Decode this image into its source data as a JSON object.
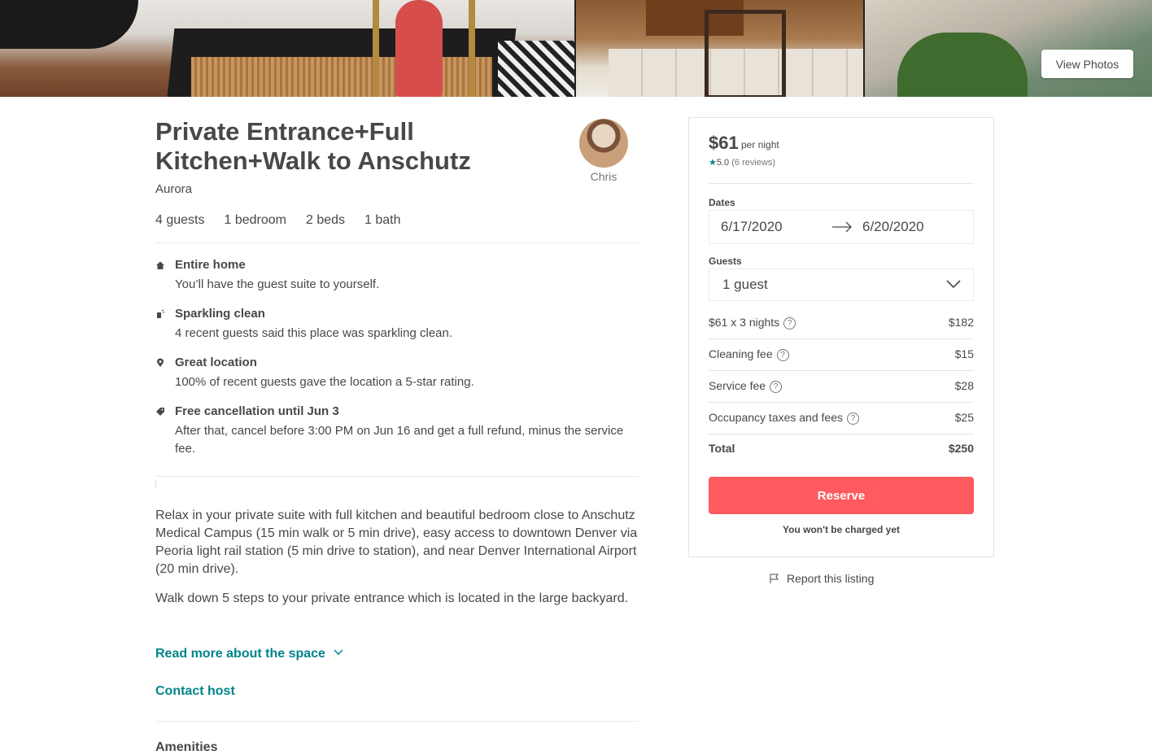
{
  "photos": {
    "view_photos_label": "View Photos"
  },
  "listing": {
    "title": "Private Entrance+Full Kitchen+Walk to Anschutz",
    "city": "Aurora",
    "host_name": "Chris",
    "stats": [
      "4 guests",
      "1 bedroom",
      "2 beds",
      "1 bath"
    ]
  },
  "highlights": [
    {
      "icon": "home-icon",
      "title": "Entire home",
      "desc": "You’ll have the guest suite to yourself."
    },
    {
      "icon": "broom-icon",
      "title": "Sparkling clean",
      "desc": "4 recent guests said this place was sparkling clean."
    },
    {
      "icon": "location-pin-icon",
      "title": "Great location",
      "desc": "100% of recent guests gave the location a 5-star rating."
    },
    {
      "icon": "tag-icon",
      "title": "Free cancellation until Jun 3",
      "desc": "After that, cancel before 3:00 PM on Jun 16 and get a full refund, minus the service fee."
    }
  ],
  "description": {
    "p1": "Relax in your private suite with full kitchen and beautiful bedroom close to Anschutz Medical Campus (15 min walk or 5 min drive), easy access to downtown Denver via Peoria light rail station (5 min drive to station), and near Denver International Airport (20 min drive).",
    "p2": "Walk down 5 steps to your private entrance which is located in the large backyard.",
    "read_more": "Read more about the space",
    "contact_host": "Contact host"
  },
  "amenities_heading": "Amenities",
  "booking": {
    "price": "$61",
    "per_night": "per night",
    "rating": "5.0",
    "reviews": "(6 reviews)",
    "dates_label": "Dates",
    "check_in": "6/17/2020",
    "check_out": "6/20/2020",
    "guests_label": "Guests",
    "guests_value": "1 guest",
    "fees": [
      {
        "label": "$61 x 3 nights",
        "value": "$182"
      },
      {
        "label": "Cleaning fee",
        "value": "$15"
      },
      {
        "label": "Service fee",
        "value": "$28"
      },
      {
        "label": "Occupancy taxes and fees",
        "value": "$25"
      }
    ],
    "total_label": "Total",
    "total_value": "$250",
    "reserve_label": "Reserve",
    "not_charged": "You won't be charged yet",
    "accent_color": "#ff5a5f",
    "link_color": "#008489"
  },
  "report_listing": "Report this listing"
}
